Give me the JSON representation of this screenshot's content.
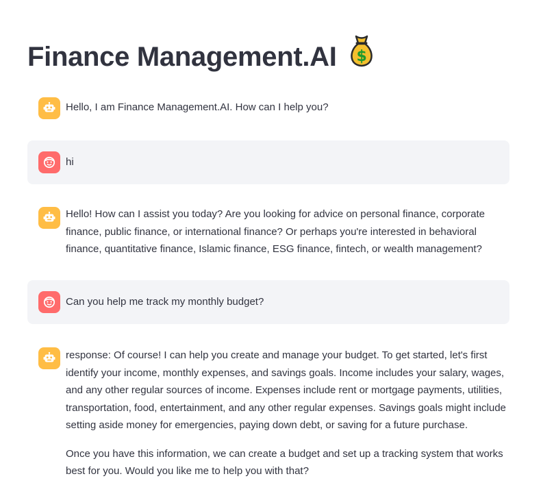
{
  "app": {
    "title": "Finance Management.AI",
    "title_icon": "money-bag-icon"
  },
  "colors": {
    "text": "#31333f",
    "user_bubble_bg": "#f3f4f7",
    "assistant_avatar": "#ffbd45",
    "user_avatar": "#ff6b6b"
  },
  "messages": [
    {
      "role": "assistant",
      "avatar_icon": "robot-icon",
      "paragraphs": [
        "Hello, I am Finance Management.AI. How can I help you?"
      ]
    },
    {
      "role": "user",
      "avatar_icon": "smiley-face-icon",
      "paragraphs": [
        "hi"
      ]
    },
    {
      "role": "assistant",
      "avatar_icon": "robot-icon",
      "paragraphs": [
        "Hello! How can I assist you today? Are you looking for advice on personal finance, corporate finance, public finance, or international finance? Or perhaps you're interested in behavioral finance, quantitative finance, Islamic finance, ESG finance, fintech, or wealth management?"
      ]
    },
    {
      "role": "user",
      "avatar_icon": "smiley-face-icon",
      "paragraphs": [
        "Can you help me track my monthly budget?"
      ]
    },
    {
      "role": "assistant",
      "avatar_icon": "robot-icon",
      "paragraphs": [
        "response: Of course! I can help you create and manage your budget. To get started, let's first identify your income, monthly expenses, and savings goals. Income includes your salary, wages, and any other regular sources of income. Expenses include rent or mortgage payments, utilities, transportation, food, entertainment, and any other regular expenses. Savings goals might include setting aside money for emergencies, paying down debt, or saving for a future purchase.",
        "Once you have this information, we can create a budget and set up a tracking system that works best for you. Would you like me to help you with that?"
      ]
    }
  ]
}
